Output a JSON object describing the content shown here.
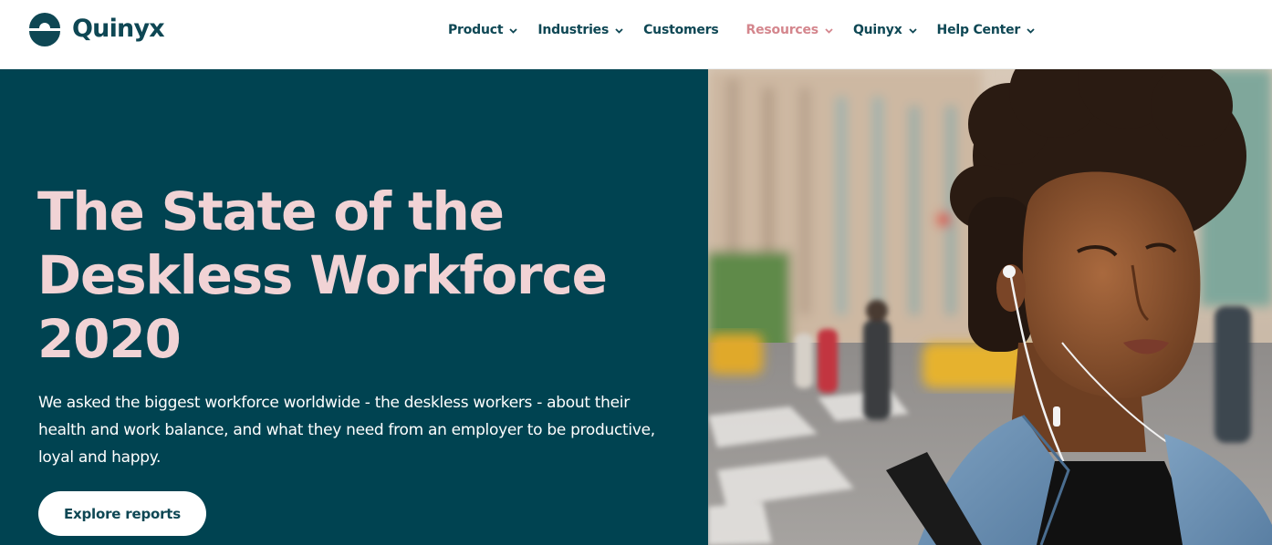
{
  "brand": {
    "name": "Quinyx",
    "primary_color": "#0e4754",
    "hero_bg": "#004351",
    "title_color": "#f1d3d5",
    "active_color": "#d4868d"
  },
  "nav": {
    "items": [
      {
        "label": "Product",
        "has_dropdown": true,
        "active": false
      },
      {
        "label": "Industries",
        "has_dropdown": true,
        "active": false
      },
      {
        "label": "Customers",
        "has_dropdown": false,
        "active": false
      },
      {
        "label": "Resources",
        "has_dropdown": true,
        "active": true
      },
      {
        "label": "Quinyx",
        "has_dropdown": true,
        "active": false
      },
      {
        "label": "Help Center",
        "has_dropdown": true,
        "active": false
      }
    ]
  },
  "hero": {
    "title_lines": [
      "The State of the",
      "Deskless Workforce",
      "2020"
    ],
    "description": "We asked the biggest workforce worldwide - the deskless workers - about their health and work balance, and what they need from an employer to be productive, loyal and happy.",
    "cta_label": "Explore reports",
    "image_icon": "photo-woman-with-earphones-city-street"
  }
}
